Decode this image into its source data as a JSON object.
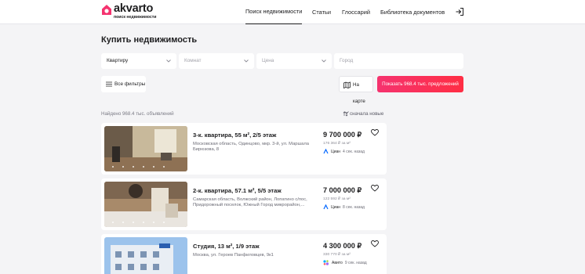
{
  "header": {
    "logo_text": "akvarto",
    "logo_subtitle": "поиск недвижимости",
    "nav": [
      "Поиск недвижимости",
      "Статьи",
      "Глоссарий",
      "Библиотека документов"
    ],
    "active_nav": 0
  },
  "page_title": "Купить недвижимость",
  "filters": {
    "type_value": "Квартиру",
    "rooms_placeholder": "Комнат",
    "price_placeholder": "Цена",
    "city_placeholder": "Город",
    "all_filters_label": "Все фильтры",
    "map_label": "На карте",
    "show_label": "Показать 968.4 тыс. предложений"
  },
  "results": {
    "found_text": "Найдено 968.4 тыс. объявлений",
    "sort_label": "сначала новые"
  },
  "listings": [
    {
      "title": "3-к. квартира, 55 м², 2/5 этаж",
      "address": "Московская область, Одинцово, мкр. 3-й, ул. Маршала Бирюзова, 8",
      "price": "9 700 000 ₽",
      "price_per_m2": "176 364 ₽ за м²",
      "source": "Циан",
      "time": "4 сек. назад"
    },
    {
      "title": "2-к. квартира, 57.1 м², 5/5 этаж",
      "address": "Самарская область, Волжский район, Лопатино с/пос, Придорожный поселок, Южный Город микрорайон,...",
      "price": "7 000 000 ₽",
      "price_per_m2": "122 592 ₽ за м²",
      "source": "Циан",
      "time": "8 сек. назад"
    },
    {
      "title": "Студия, 13 м², 1/9 этаж",
      "address": "Москва, ул. Героев Панфиловцев, 9к1",
      "price": "4 300 000 ₽",
      "price_per_m2": "330 770 ₽ за м²",
      "source": "Авито",
      "time": "9 сек. назад"
    }
  ],
  "colors": {
    "accent": "#f5336f",
    "accent_end": "#ff2e44",
    "background": "#f4f4f6",
    "cian": "#0468ff"
  }
}
